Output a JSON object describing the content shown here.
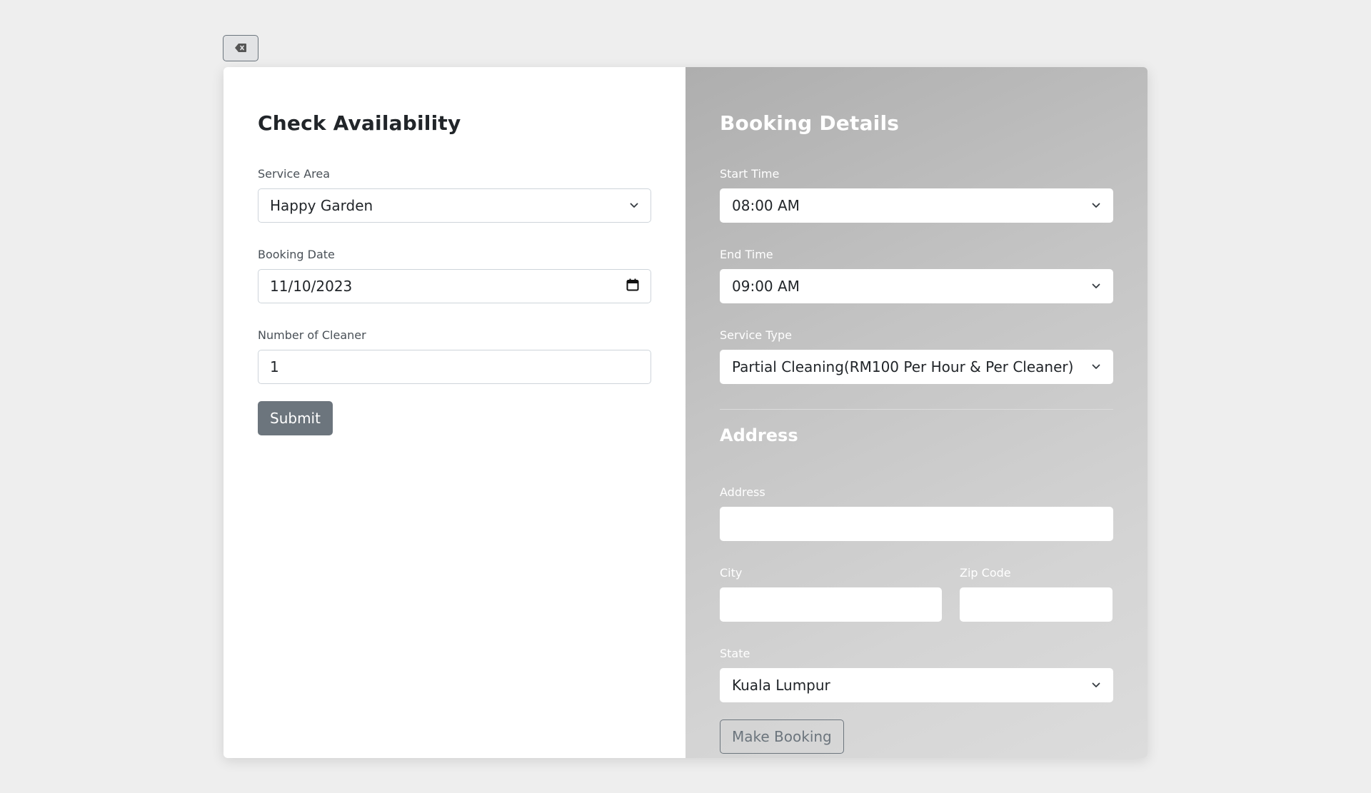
{
  "back_button": {
    "icon": "backspace-icon"
  },
  "check": {
    "title": "Check Availability",
    "service_area": {
      "label": "Service Area",
      "value": "Happy Garden"
    },
    "booking_date": {
      "label": "Booking Date",
      "value": "11/10/2023"
    },
    "num_cleaner": {
      "label": "Number of Cleaner",
      "value": "1"
    },
    "submit_label": "Submit"
  },
  "booking": {
    "title": "Booking Details",
    "start_time": {
      "label": "Start Time",
      "value": "08:00 AM"
    },
    "end_time": {
      "label": "End Time",
      "value": "09:00 AM"
    },
    "service_type": {
      "label": "Service Type",
      "value": "Partial Cleaning(RM100 Per Hour & Per Cleaner)"
    },
    "address_heading": "Address",
    "address": {
      "label": "Address",
      "value": ""
    },
    "city": {
      "label": "City",
      "value": ""
    },
    "zip": {
      "label": "Zip Code",
      "value": ""
    },
    "state": {
      "label": "State",
      "value": "Kuala Lumpur"
    },
    "make_booking_label": "Make Booking"
  },
  "colors": {
    "secondary": "#6c757d",
    "page_bg": "#eeeeee"
  }
}
